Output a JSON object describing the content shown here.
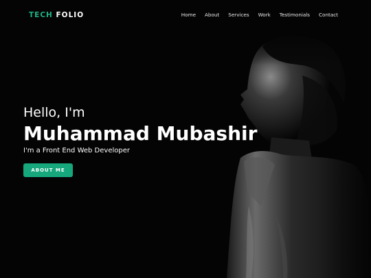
{
  "brand": {
    "logo_accent": "TECH",
    "logo_rest": "FOLIO",
    "accent_color": "#1fb386"
  },
  "nav": {
    "items": [
      {
        "label": "Home"
      },
      {
        "label": "About"
      },
      {
        "label": "Services"
      },
      {
        "label": "Work"
      },
      {
        "label": "Testimonials"
      },
      {
        "label": "Contact"
      }
    ]
  },
  "hero": {
    "greeting": "Hello, I'm",
    "name": "Muhammad Mubashir",
    "role": "I'm a Front End Web Developer",
    "cta_label": "ABOUT ME",
    "cta_color": "#16a77d",
    "background_color": "#040404",
    "photo_icon": "portrait-photo"
  }
}
